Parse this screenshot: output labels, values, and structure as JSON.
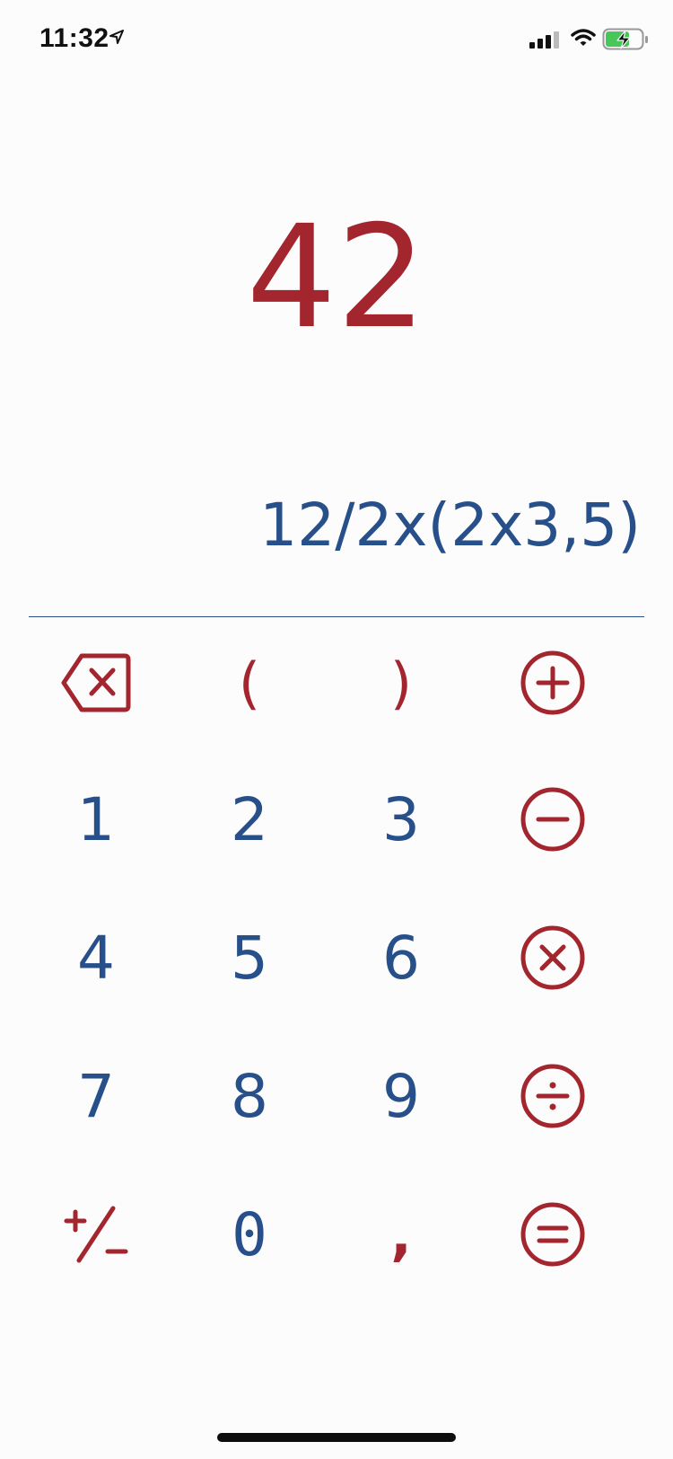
{
  "status_bar": {
    "time": "11:32"
  },
  "display": {
    "result": "42",
    "expression": "12/2x(2x3,5)"
  },
  "keys": {
    "open_paren": "(",
    "close_paren": ")",
    "d1": "1",
    "d2": "2",
    "d3": "3",
    "d4": "4",
    "d5": "5",
    "d6": "6",
    "d7": "7",
    "d8": "8",
    "d9": "9",
    "d0": "0",
    "comma": ","
  },
  "icons": {
    "backspace": "backspace-icon",
    "plus": "plus-circle-icon",
    "minus": "minus-circle-icon",
    "multiply": "multiply-circle-icon",
    "divide": "divide-circle-icon",
    "equals": "equals-circle-icon",
    "sign": "plus-minus-icon"
  },
  "colors": {
    "operator_red": "#a3262f",
    "digit_blue": "#27508b"
  }
}
